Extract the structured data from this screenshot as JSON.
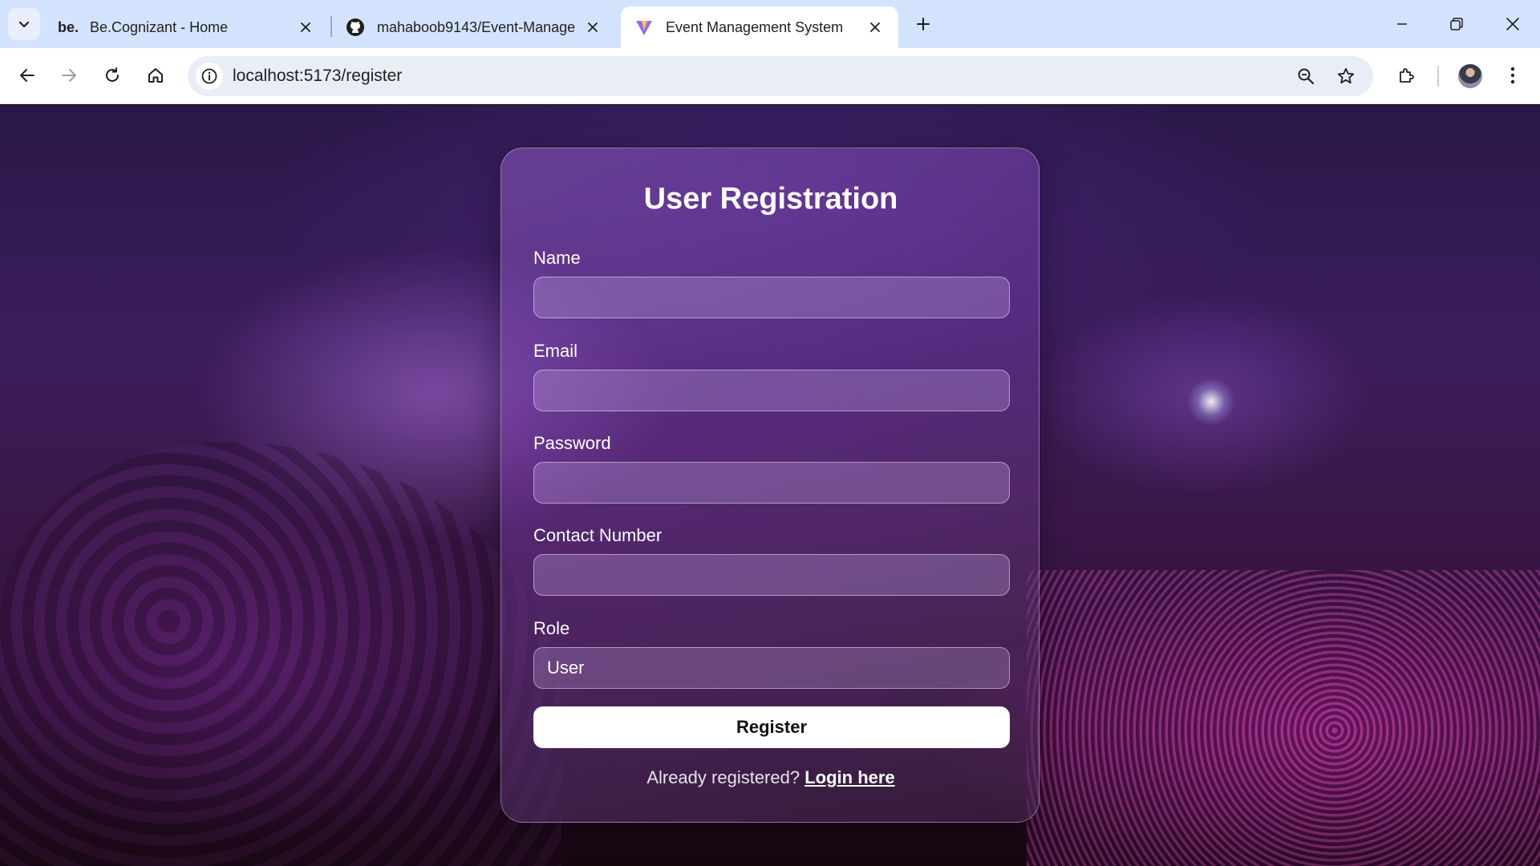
{
  "browser": {
    "tabs": [
      {
        "title": "Be.Cognizant - Home",
        "favicon_text": "be.",
        "favicon": "cognizant-logo"
      },
      {
        "title": "mahaboob9143/Event-Manage",
        "favicon": "github-icon"
      },
      {
        "title": "Event Management System",
        "favicon": "vite-icon",
        "active": true
      }
    ],
    "url": "localhost:5173/register"
  },
  "form": {
    "title": "User Registration",
    "fields": {
      "name": {
        "label": "Name",
        "value": ""
      },
      "email": {
        "label": "Email",
        "value": ""
      },
      "password": {
        "label": "Password",
        "value": ""
      },
      "contact": {
        "label": "Contact Number",
        "value": ""
      },
      "role": {
        "label": "Role",
        "value": "User"
      }
    },
    "submit_label": "Register",
    "login_prompt": "Already registered?",
    "login_link": "Login here"
  },
  "colors": {
    "tabbar": "#d3e3fd",
    "omnibox": "#e9eef6",
    "button_bg": "#ffffff",
    "card_tint": "#8c5abe"
  }
}
